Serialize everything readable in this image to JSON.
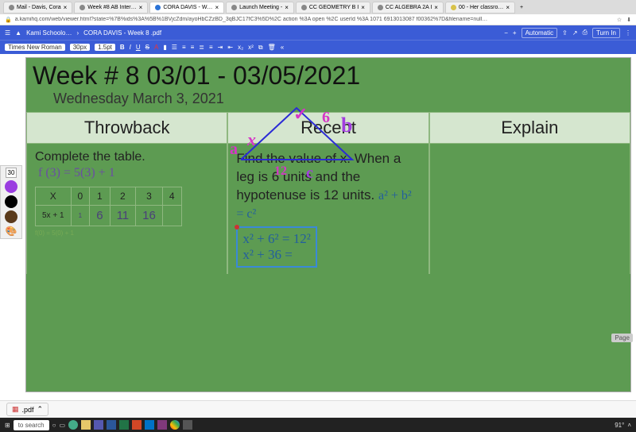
{
  "browser": {
    "tabs": [
      {
        "label": "Mail - Davis, Cora"
      },
      {
        "label": "Week #8 AB Inter…"
      },
      {
        "label": "CORA DAVIS - W…",
        "active": true
      },
      {
        "label": "Launch Meeting -"
      },
      {
        "label": "CC GEOMETRY B I"
      },
      {
        "label": "CC ALGEBRA 2A I"
      },
      {
        "label": "00 - Her classro…"
      }
    ],
    "url": "a.kamihq.com/web/viewer.html?state=%7B%ids%3A%5B%1BVjcZdm/ayoHbCZzBD_3qBJC17fC3%5D%2C action %3A open %2C userId %3A 1071 6913013087 f00362%7D&filename=null…"
  },
  "kami": {
    "breadcrumb1": "Kami Schoolo…",
    "breadcrumb2": "CORA DAVIS - Week 8 .pdf",
    "automatic": "Automatic",
    "turnin": "Turn In"
  },
  "toolbar": {
    "font": "Times New Roman",
    "size": "30px",
    "stroke": "1.5pt",
    "B": "B",
    "I": "I",
    "U": "U",
    "S": "S",
    "A": "A"
  },
  "sidebar": {
    "sizeLabel": "30",
    "colors": [
      "#9a3de0",
      "#000000",
      "#5a3a1a"
    ]
  },
  "doc": {
    "title": "Week # 8 03/01 - 03/05/2021",
    "subtitle": "Wednesday March 3, 2021",
    "headers": [
      "Throwback",
      "Recent",
      "Explain"
    ],
    "q1": {
      "prompt": "Complete the table.",
      "func": "f (3) = 5(3) + 1",
      "xrow": [
        "X",
        "0",
        "1",
        "2",
        "3",
        "4"
      ],
      "yrow": [
        "5x + 1",
        "1",
        "6",
        "11",
        "16",
        ""
      ],
      "note": "f(0) = 5(0) + 1"
    },
    "q2": {
      "prompt": "Find the value of x. When a leg is 6 units and the hypotenuse is 12 units.",
      "pythag": "a² + b² = c²",
      "step1": "x² + 6² = 12²",
      "step2": "x² + 36 ="
    },
    "annotations": {
      "a": "a",
      "x": "x",
      "check": "✓",
      "six": "6",
      "b": "b",
      "twelve": "12",
      "c": "c"
    }
  },
  "downloads": {
    "file": ".pdf"
  },
  "taskbar": {
    "search": "to search",
    "temp": "91°"
  },
  "page": "Page"
}
